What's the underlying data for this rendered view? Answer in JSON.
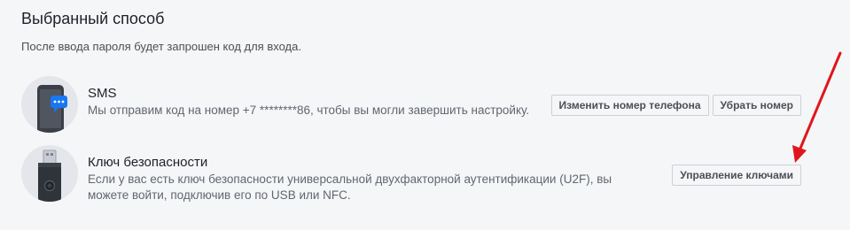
{
  "section": {
    "title": "Выбранный способ",
    "description": "После ввода пароля будет запрошен код для входа."
  },
  "methods": [
    {
      "name": "SMS",
      "icon": "phone-sms-icon",
      "description": "Мы отправим код на номер +7 ********86, чтобы вы могли завершить настройку.",
      "buttons": [
        "Изменить номер телефона",
        "Убрать номер"
      ]
    },
    {
      "name": "Ключ безопасности",
      "icon": "usb-security-key-icon",
      "description": "Если у вас есть ключ безопасности универсальной двухфакторной аутентификации (U2F), вы можете войти, подключив его по USB или NFC.",
      "buttons": [
        "Управление ключами"
      ]
    }
  ],
  "annotation": {
    "arrow_color": "#e0161c"
  }
}
